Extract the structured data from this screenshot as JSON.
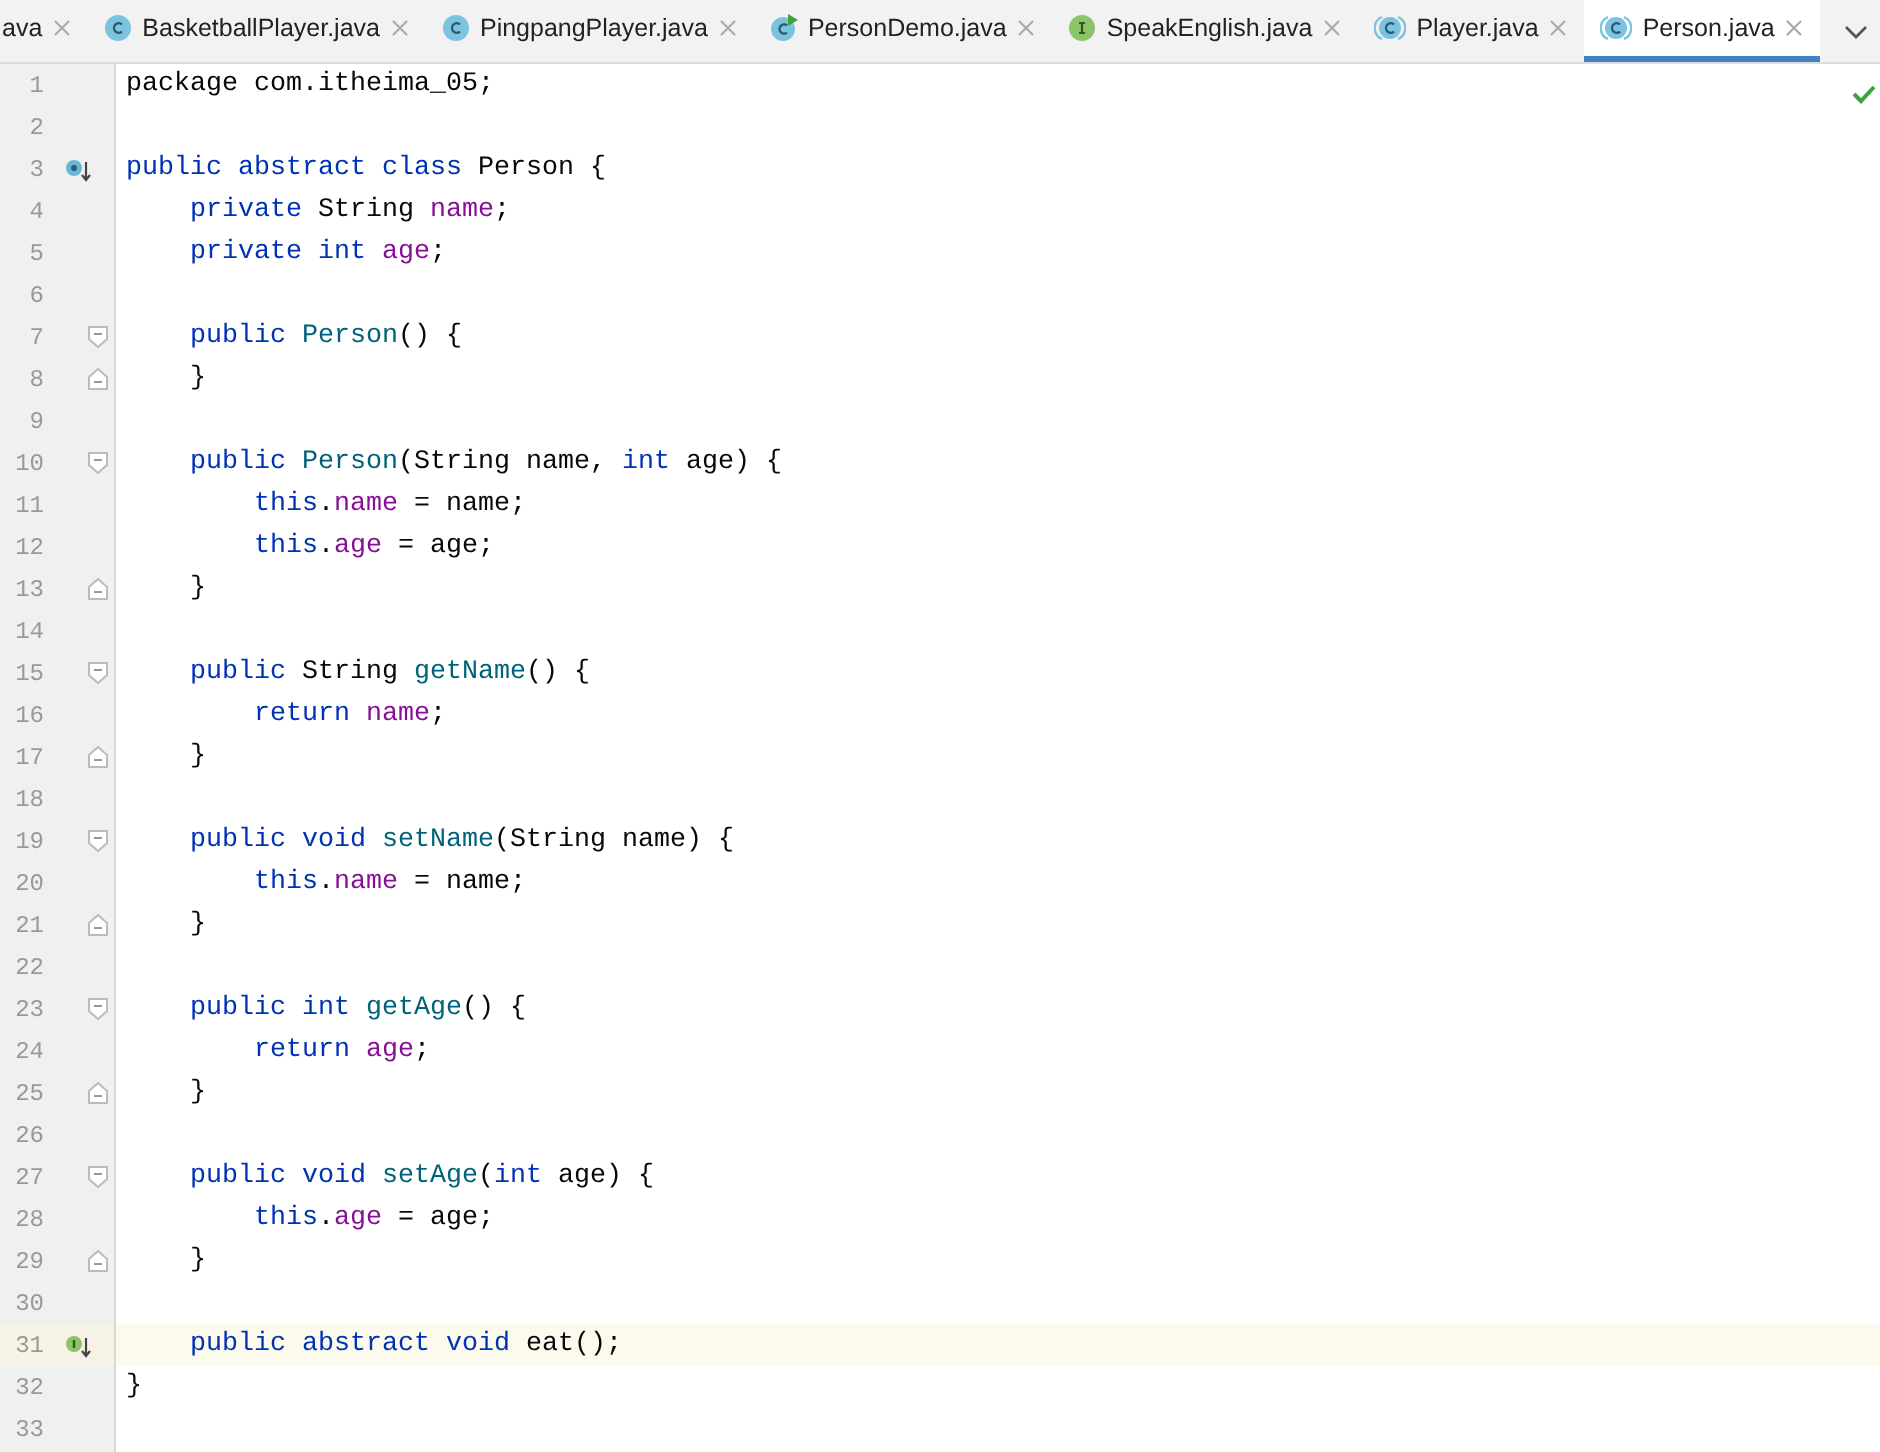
{
  "tabs": [
    {
      "label": "ava",
      "kind": "none",
      "selected": false
    },
    {
      "label": "BasketballPlayer.java",
      "kind": "class",
      "selected": false
    },
    {
      "label": "PingpangPlayer.java",
      "kind": "class",
      "selected": false
    },
    {
      "label": "PersonDemo.java",
      "kind": "runnable",
      "selected": false
    },
    {
      "label": "SpeakEnglish.java",
      "kind": "interface",
      "selected": false
    },
    {
      "label": "Player.java",
      "kind": "abstract",
      "selected": false
    },
    {
      "label": "Person.java",
      "kind": "abstract",
      "selected": true
    }
  ],
  "editor": {
    "lines": [
      {
        "number": "1",
        "kind": "none",
        "current": false,
        "tokens": [
          {
            "kind": "plain",
            "t": "package com.itheima_05;"
          }
        ]
      },
      {
        "number": "2",
        "kind": "none",
        "current": false
      },
      {
        "number": "3",
        "kind": "implemented",
        "current": false,
        "tokens": [
          {
            "kind": "keyword",
            "t": "public abstract class "
          },
          {
            "kind": "plain",
            "t": "Person {"
          }
        ]
      },
      {
        "number": "4",
        "kind": "none",
        "current": false,
        "tokens": [
          {
            "kind": "keyword",
            "t": "    private "
          },
          {
            "kind": "plain",
            "t": "String "
          },
          {
            "kind": "field",
            "t": "name"
          },
          {
            "kind": "plain",
            "t": ";"
          }
        ]
      },
      {
        "number": "5",
        "kind": "none",
        "current": false,
        "tokens": [
          {
            "kind": "keyword",
            "t": "    private int "
          },
          {
            "kind": "field",
            "t": "age"
          },
          {
            "kind": "plain",
            "t": ";"
          }
        ]
      },
      {
        "number": "6",
        "kind": "none",
        "current": false
      },
      {
        "number": "7",
        "kind": "foldstart",
        "current": false,
        "tokens": [
          {
            "kind": "keyword",
            "t": "    public "
          },
          {
            "kind": "method",
            "t": "Person"
          },
          {
            "kind": "plain",
            "t": "() {"
          }
        ]
      },
      {
        "number": "8",
        "kind": "foldend",
        "current": false,
        "tokens": [
          {
            "kind": "plain",
            "t": "    }"
          }
        ]
      },
      {
        "number": "9",
        "kind": "none",
        "current": false
      },
      {
        "number": "10",
        "kind": "foldstart",
        "current": false,
        "tokens": [
          {
            "kind": "keyword",
            "t": "    public "
          },
          {
            "kind": "method",
            "t": "Person"
          },
          {
            "kind": "plain",
            "t": "(String name, "
          },
          {
            "kind": "keyword",
            "t": "int "
          },
          {
            "kind": "plain",
            "t": "age) {"
          }
        ]
      },
      {
        "number": "11",
        "kind": "none",
        "current": false,
        "tokens": [
          {
            "kind": "keyword",
            "t": "        this"
          },
          {
            "kind": "plain",
            "t": "."
          },
          {
            "kind": "field",
            "t": "name"
          },
          {
            "kind": "plain",
            "t": " = name;"
          }
        ]
      },
      {
        "number": "12",
        "kind": "none",
        "current": false,
        "tokens": [
          {
            "kind": "keyword",
            "t": "        this"
          },
          {
            "kind": "plain",
            "t": "."
          },
          {
            "kind": "field",
            "t": "age"
          },
          {
            "kind": "plain",
            "t": " = age;"
          }
        ]
      },
      {
        "number": "13",
        "kind": "foldend",
        "current": false,
        "tokens": [
          {
            "kind": "plain",
            "t": "    }"
          }
        ]
      },
      {
        "number": "14",
        "kind": "none",
        "current": false
      },
      {
        "number": "15",
        "kind": "foldstart",
        "current": false,
        "tokens": [
          {
            "kind": "keyword",
            "t": "    public "
          },
          {
            "kind": "plain",
            "t": "String "
          },
          {
            "kind": "method",
            "t": "getName"
          },
          {
            "kind": "plain",
            "t": "() {"
          }
        ]
      },
      {
        "number": "16",
        "kind": "none",
        "current": false,
        "tokens": [
          {
            "kind": "keyword",
            "t": "        return "
          },
          {
            "kind": "field",
            "t": "name"
          },
          {
            "kind": "plain",
            "t": ";"
          }
        ]
      },
      {
        "number": "17",
        "kind": "foldend",
        "current": false,
        "tokens": [
          {
            "kind": "plain",
            "t": "    }"
          }
        ]
      },
      {
        "number": "18",
        "kind": "none",
        "current": false
      },
      {
        "number": "19",
        "kind": "foldstart",
        "current": false,
        "tokens": [
          {
            "kind": "keyword",
            "t": "    public void "
          },
          {
            "kind": "method",
            "t": "setName"
          },
          {
            "kind": "plain",
            "t": "(String name) {"
          }
        ]
      },
      {
        "number": "20",
        "kind": "none",
        "current": false,
        "tokens": [
          {
            "kind": "keyword",
            "t": "        this"
          },
          {
            "kind": "plain",
            "t": "."
          },
          {
            "kind": "field",
            "t": "name"
          },
          {
            "kind": "plain",
            "t": " = name;"
          }
        ]
      },
      {
        "number": "21",
        "kind": "foldend",
        "current": false,
        "tokens": [
          {
            "kind": "plain",
            "t": "    }"
          }
        ]
      },
      {
        "number": "22",
        "kind": "none",
        "current": false
      },
      {
        "number": "23",
        "kind": "foldstart",
        "current": false,
        "tokens": [
          {
            "kind": "keyword",
            "t": "    public int "
          },
          {
            "kind": "method",
            "t": "getAge"
          },
          {
            "kind": "plain",
            "t": "() {"
          }
        ]
      },
      {
        "number": "24",
        "kind": "none",
        "current": false,
        "tokens": [
          {
            "kind": "keyword",
            "t": "        return "
          },
          {
            "kind": "field",
            "t": "age"
          },
          {
            "kind": "plain",
            "t": ";"
          }
        ]
      },
      {
        "number": "25",
        "kind": "foldend",
        "current": false,
        "tokens": [
          {
            "kind": "plain",
            "t": "    }"
          }
        ]
      },
      {
        "number": "26",
        "kind": "none",
        "current": false
      },
      {
        "number": "27",
        "kind": "foldstart",
        "current": false,
        "tokens": [
          {
            "kind": "keyword",
            "t": "    public void "
          },
          {
            "kind": "method",
            "t": "setAge"
          },
          {
            "kind": "plain",
            "t": "("
          },
          {
            "kind": "keyword",
            "t": "int "
          },
          {
            "kind": "plain",
            "t": "age) {"
          }
        ]
      },
      {
        "number": "28",
        "kind": "none",
        "current": false,
        "tokens": [
          {
            "kind": "keyword",
            "t": "        this"
          },
          {
            "kind": "plain",
            "t": "."
          },
          {
            "kind": "field",
            "t": "age"
          },
          {
            "kind": "plain",
            "t": " = age;"
          }
        ]
      },
      {
        "number": "29",
        "kind": "foldend",
        "current": false,
        "tokens": [
          {
            "kind": "plain",
            "t": "    }"
          }
        ]
      },
      {
        "number": "30",
        "kind": "none",
        "current": false
      },
      {
        "number": "31",
        "kind": "implements",
        "current": true,
        "tokens": [
          {
            "kind": "keyword",
            "t": "    public abstract void "
          },
          {
            "kind": "plain",
            "t": "eat();"
          }
        ]
      },
      {
        "number": "32",
        "kind": "none",
        "current": false,
        "tokens": [
          {
            "kind": "plain",
            "t": "}"
          }
        ]
      },
      {
        "number": "33",
        "kind": "none",
        "current": false
      }
    ]
  }
}
